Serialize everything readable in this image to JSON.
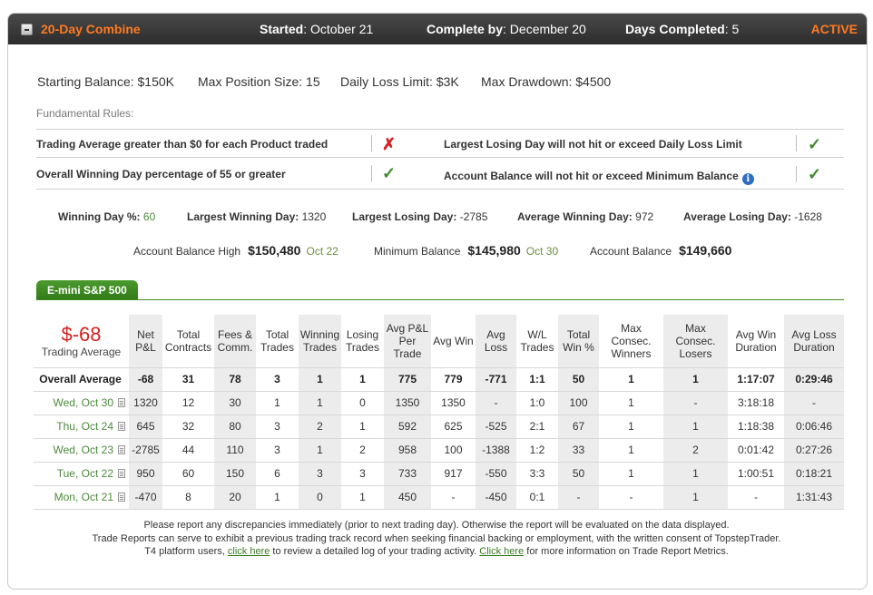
{
  "header": {
    "title": "20-Day Combine",
    "started_label": "Started",
    "started_value": "October 21",
    "complete_label": "Complete by",
    "complete_value": "December 20",
    "days_label": "Days Completed",
    "days_value": "5",
    "status": "ACTIVE"
  },
  "params": {
    "starting_balance": "Starting Balance: $150K",
    "max_position": "Max Position Size: 15",
    "daily_loss": "Daily Loss Limit: $3K",
    "max_drawdown": "Max Drawdown: $4500"
  },
  "rules": {
    "label": "Fundamental Rules:",
    "items": [
      {
        "text": "Trading Average greater than $0 for each Product traded",
        "passed": false
      },
      {
        "text": "Largest Losing Day will not hit or exceed Daily Loss Limit",
        "passed": true
      },
      {
        "text": "Overall Winning Day percentage of 55 or greater",
        "passed": true
      },
      {
        "text": "Account Balance will not hit or exceed Minimum Balance",
        "passed": true
      }
    ],
    "fail_mark": "✗",
    "pass_mark": "✓"
  },
  "stats": {
    "winning_day_label": "Winning Day %:",
    "winning_day_value": "60",
    "largest_win_label": "Largest Winning Day:",
    "largest_win_value": "1320",
    "largest_loss_label": "Largest Losing Day:",
    "largest_loss_value": "-2785",
    "avg_win_label": "Average Winning Day:",
    "avg_win_value": "972",
    "avg_loss_label": "Average Losing Day:",
    "avg_loss_value": "-1628"
  },
  "balances": {
    "high_label": "Account Balance High",
    "high_value": "$150,480",
    "high_date": "Oct 22",
    "min_label": "Minimum Balance",
    "min_value": "$145,980",
    "min_date": "Oct 30",
    "current_label": "Account Balance",
    "current_value": "$149,660"
  },
  "product_tab": "E-mini S&P 500",
  "summary": {
    "pl": "$-68",
    "label": "Trading Average"
  },
  "columns": [
    "Net P&L",
    "Total Contracts",
    "Fees & Comm.",
    "Total Trades",
    "Winning Trades",
    "Losing Trades",
    "Avg P&L Per Trade",
    "Avg Win",
    "Avg Loss",
    "W/L Trades",
    "Total Win %",
    "Max Consec. Winners",
    "Max Consec. Losers",
    "Avg Win Duration",
    "Avg Loss Duration"
  ],
  "overall": {
    "label": "Overall Average",
    "values": [
      "-68",
      "31",
      "78",
      "3",
      "1",
      "1",
      "775",
      "779",
      "-771",
      "1:1",
      "50",
      "1",
      "1",
      "1:17:07",
      "0:29:46"
    ]
  },
  "rows": [
    {
      "date": "Wed, Oct 30",
      "values": [
        "1320",
        "12",
        "30",
        "1",
        "1",
        "0",
        "1350",
        "1350",
        "-",
        "1:0",
        "100",
        "1",
        "-",
        "3:18:18",
        "-"
      ]
    },
    {
      "date": "Thu, Oct 24",
      "values": [
        "645",
        "32",
        "80",
        "3",
        "2",
        "1",
        "592",
        "625",
        "-525",
        "2:1",
        "67",
        "1",
        "1",
        "1:18:38",
        "0:06:46"
      ]
    },
    {
      "date": "Wed, Oct 23",
      "values": [
        "-2785",
        "44",
        "110",
        "3",
        "1",
        "2",
        "958",
        "100",
        "-1388",
        "1:2",
        "33",
        "1",
        "2",
        "0:01:42",
        "0:27:26"
      ]
    },
    {
      "date": "Tue, Oct 22",
      "values": [
        "950",
        "60",
        "150",
        "6",
        "3",
        "3",
        "733",
        "917",
        "-550",
        "3:3",
        "50",
        "1",
        "1",
        "1:00:51",
        "0:18:21"
      ]
    },
    {
      "date": "Mon, Oct 21",
      "values": [
        "-470",
        "8",
        "20",
        "1",
        "0",
        "1",
        "450",
        "-",
        "-450",
        "0:1",
        "-",
        "-",
        "1",
        "-",
        "1:31:43"
      ]
    }
  ],
  "footer": {
    "line1": "Please report any discrepancies immediately (prior to next trading day). Otherwise the report will be evaluated on the data displayed.",
    "line2": "Trade Reports can serve to exhibit a previous trading track record when seeking financial backing or employment, with the written consent of TopstepTrader.",
    "line3_a": "T4 platform users,",
    "link1": "click here",
    "line3_b": "to review a detailed log of your trading activity.",
    "link2": "Click here",
    "line3_c": "for more information on Trade Report Metrics."
  }
}
